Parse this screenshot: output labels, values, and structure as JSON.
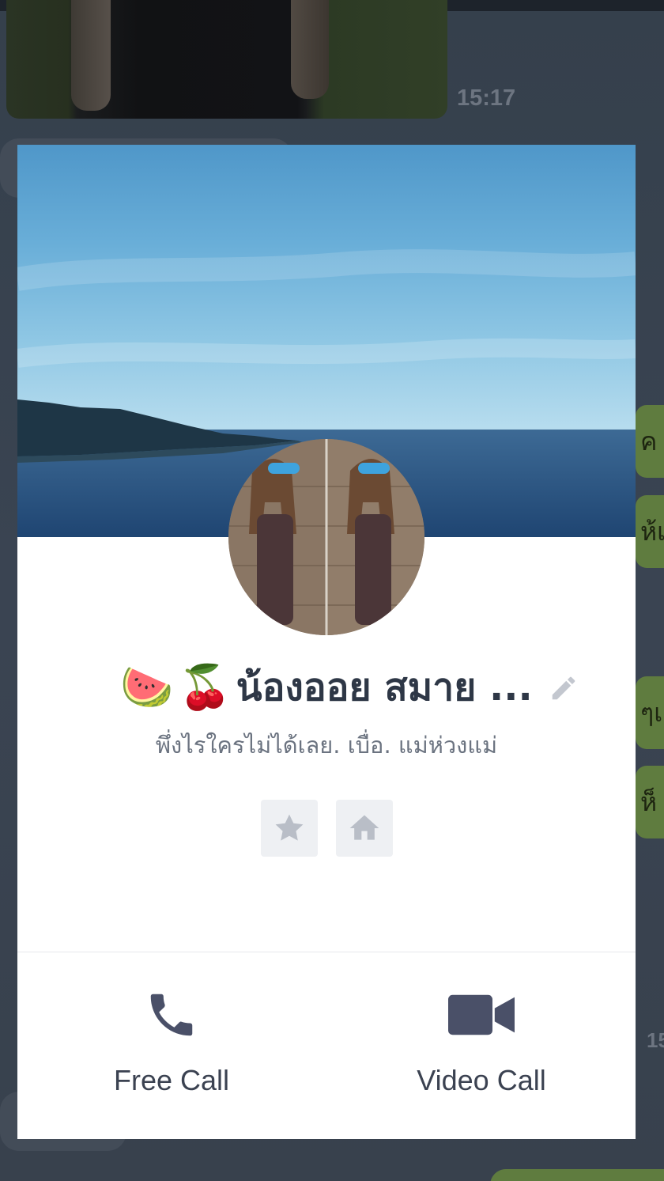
{
  "chat": {
    "timestamp": "15:17",
    "right_bubbles": [
      "ค",
      "ห้เ",
      "ๆเ",
      "ห็"
    ],
    "edge_time": "15"
  },
  "profile": {
    "emojis": [
      "🍉",
      "🍒"
    ],
    "name": "น้องออย สมาย ...",
    "status_message": "พึ่งไรใครไม่ได้เลย. เบื่อ. แม่ห่วงแม่",
    "favorite_icon": "star-icon",
    "home_icon": "home-icon",
    "edit_icon": "pencil-icon"
  },
  "actions": {
    "free_call_label": "Free Call",
    "video_call_label": "Video Call"
  },
  "colors": {
    "overlay": "#3b4350",
    "card": "#ffffff",
    "name": "#2e3746",
    "status": "#6b7380",
    "icon_dark": "#4a5068",
    "icon_muted": "#b9bec7",
    "bubble_green": "#5f7c3f"
  }
}
